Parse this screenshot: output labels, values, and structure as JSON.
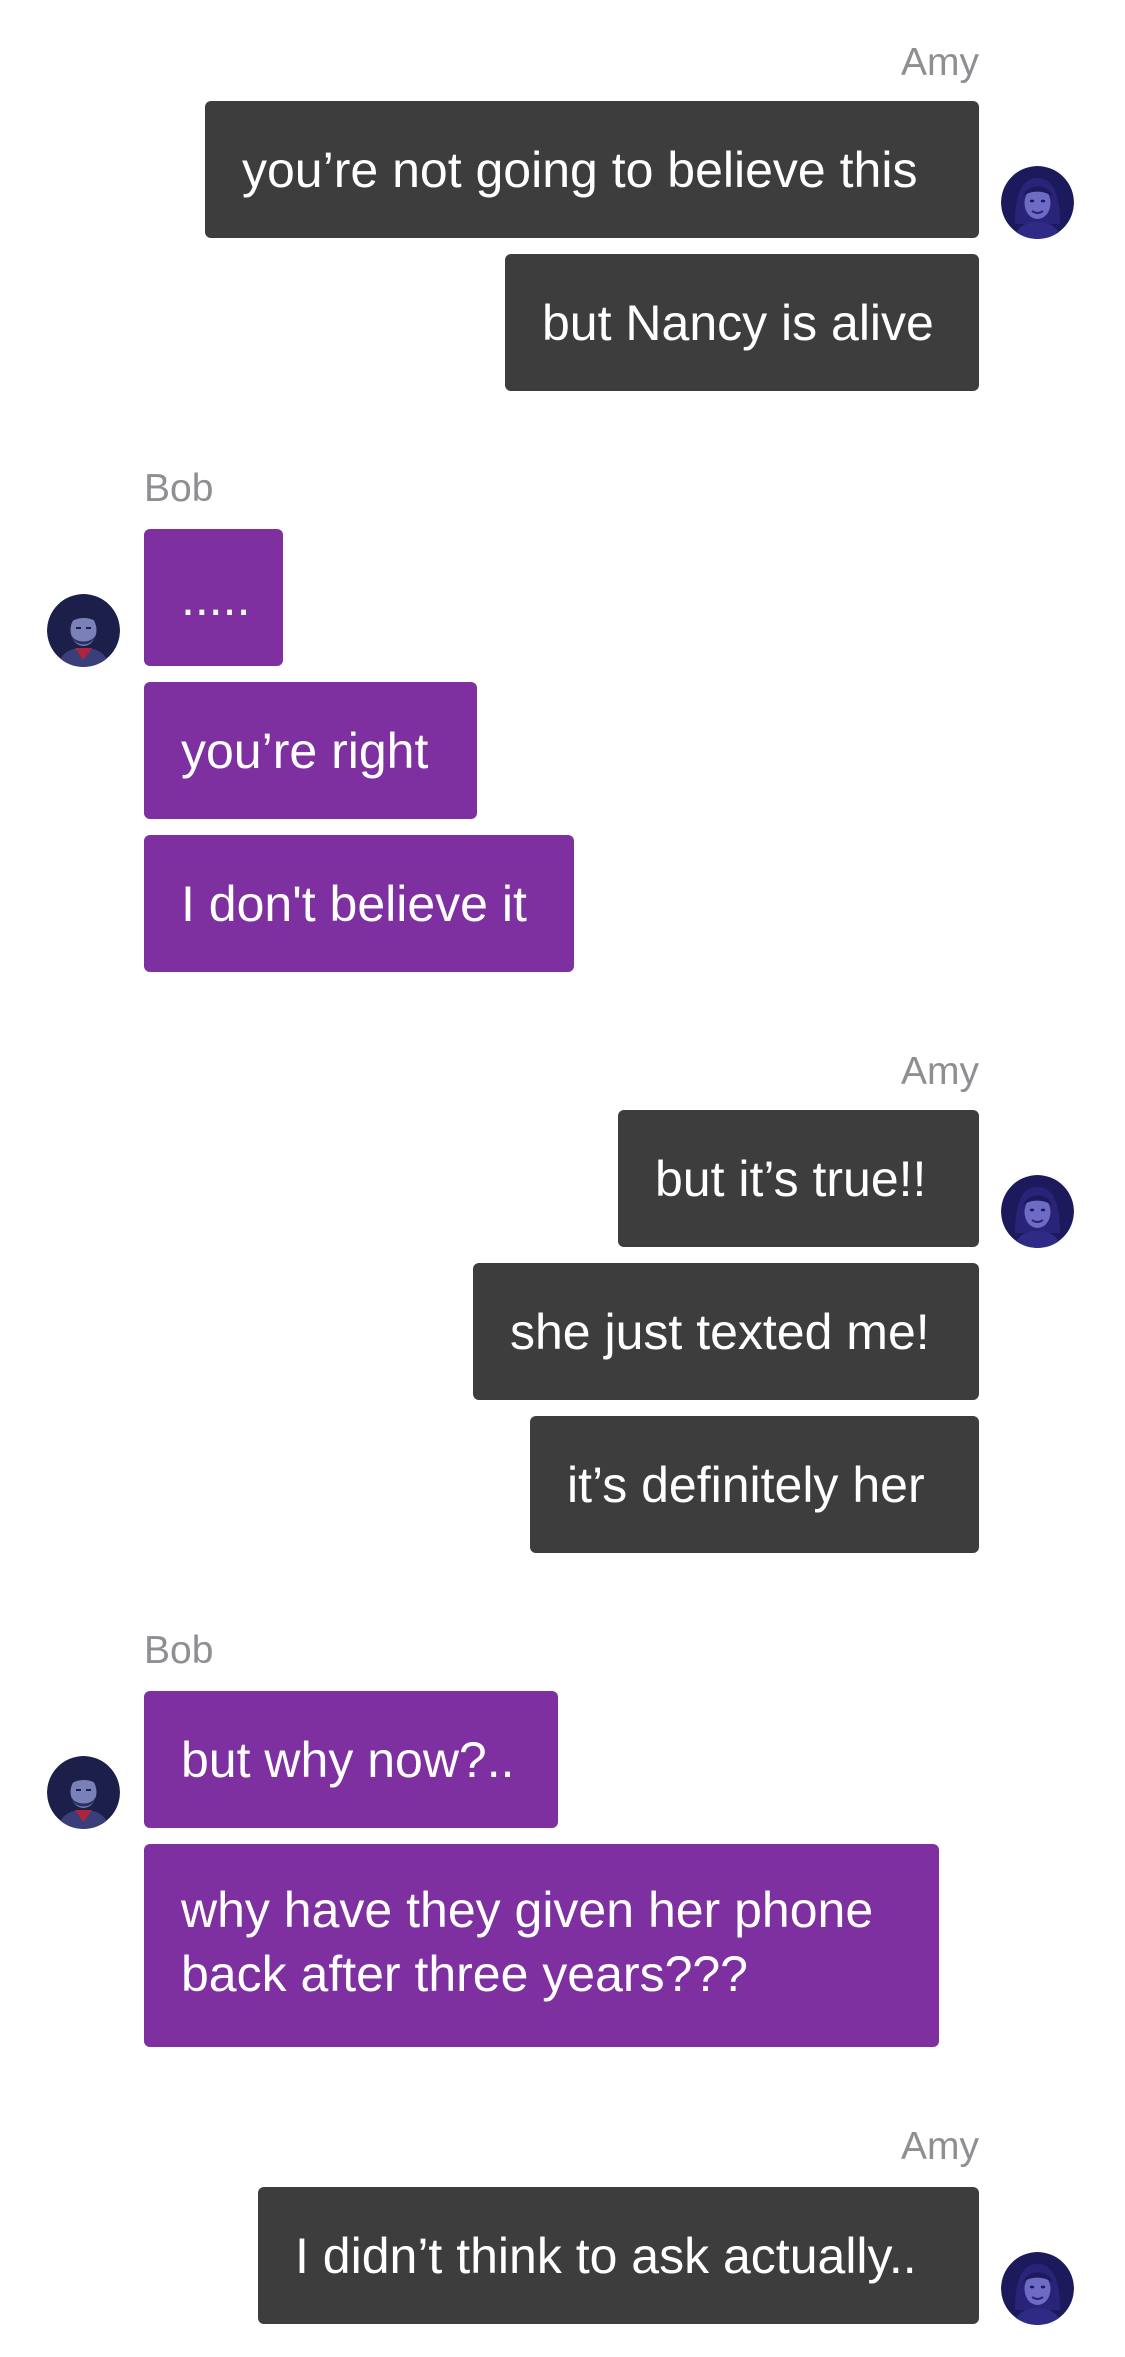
{
  "participants": {
    "amy": {
      "name": "Amy",
      "bubble_color": "#3d3d3d",
      "avatar_icon": "woman-avatar-icon"
    },
    "bob": {
      "name": "Bob",
      "bubble_color": "#7e2fa0",
      "avatar_icon": "man-avatar-icon"
    }
  },
  "text_color": "#ffffff",
  "sender_label_color": "#8e8e93",
  "groups": [
    {
      "sender": "Amy",
      "messages": [
        "you’re not going to believe this",
        "but Nancy is alive"
      ]
    },
    {
      "sender": "Bob",
      "messages": [
        ".....",
        "you’re right",
        "I don't believe it"
      ]
    },
    {
      "sender": "Amy",
      "messages": [
        "but it’s true!!",
        "she just texted me!",
        "it’s definitely her"
      ]
    },
    {
      "sender": "Bob",
      "messages": [
        "but why now?..",
        "why have they given her phone back after three years???"
      ]
    },
    {
      "sender": "Amy",
      "messages": [
        "I didn’t think to ask actually.."
      ]
    }
  ]
}
